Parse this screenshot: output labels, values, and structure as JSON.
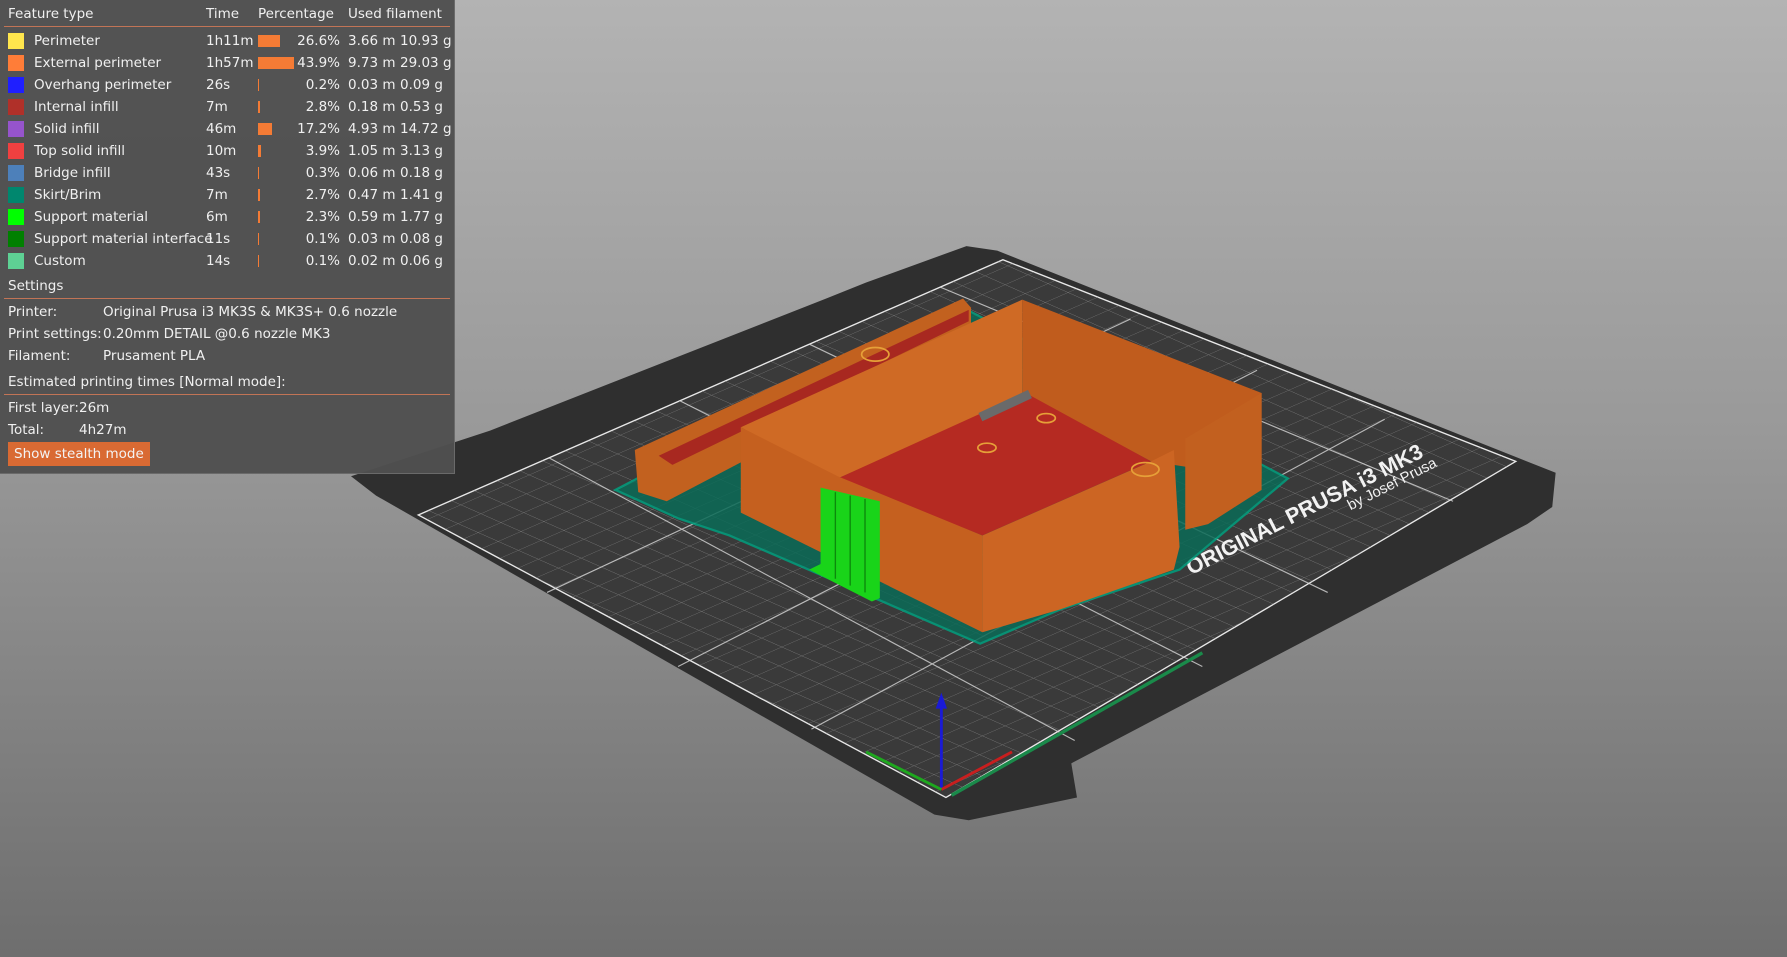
{
  "legend": {
    "headers": {
      "feature": "Feature type",
      "time": "Time",
      "percentage": "Percentage",
      "filament": "Used filament"
    },
    "rows": [
      {
        "name": "Perimeter",
        "color": "#ffe64d",
        "time": "1h11m",
        "percent": 26.6,
        "percent_label": "26.6%",
        "length": "3.66 m",
        "weight": "10.93 g"
      },
      {
        "name": "External perimeter",
        "color": "#ff7d38",
        "time": "1h57m",
        "percent": 43.9,
        "percent_label": "43.9%",
        "length": "9.73 m",
        "weight": "29.03 g"
      },
      {
        "name": "Overhang perimeter",
        "color": "#1f1fff",
        "time": "26s",
        "percent": 0.2,
        "percent_label": "0.2%",
        "length": "0.03 m",
        "weight": "0.09 g"
      },
      {
        "name": "Internal infill",
        "color": "#b03029",
        "time": "7m",
        "percent": 2.8,
        "percent_label": "2.8%",
        "length": "0.18 m",
        "weight": "0.53 g"
      },
      {
        "name": "Solid infill",
        "color": "#9654cc",
        "time": "46m",
        "percent": 17.2,
        "percent_label": "17.2%",
        "length": "4.93 m",
        "weight": "14.72 g"
      },
      {
        "name": "Top solid infill",
        "color": "#f04040",
        "time": "10m",
        "percent": 3.9,
        "percent_label": "3.9%",
        "length": "1.05 m",
        "weight": "3.13 g"
      },
      {
        "name": "Bridge infill",
        "color": "#4d80ba",
        "time": "43s",
        "percent": 0.3,
        "percent_label": "0.3%",
        "length": "0.06 m",
        "weight": "0.18 g"
      },
      {
        "name": "Skirt/Brim",
        "color": "#00876e",
        "time": "7m",
        "percent": 2.7,
        "percent_label": "2.7%",
        "length": "0.47 m",
        "weight": "1.41 g"
      },
      {
        "name": "Support material",
        "color": "#00ff00",
        "time": "6m",
        "percent": 2.3,
        "percent_label": "2.3%",
        "length": "0.59 m",
        "weight": "1.77 g"
      },
      {
        "name": "Support material interface",
        "color": "#008000",
        "time": "11s",
        "percent": 0.1,
        "percent_label": "0.1%",
        "length": "0.03 m",
        "weight": "0.08 g"
      },
      {
        "name": "Custom",
        "color": "#5ed194",
        "time": "14s",
        "percent": 0.1,
        "percent_label": "0.1%",
        "length": "0.02 m",
        "weight": "0.06 g"
      }
    ],
    "bar_color": "#f47b35"
  },
  "settings": {
    "title": "Settings",
    "printer_label": "Printer:",
    "printer": "Original Prusa i3 MK3S & MK3S+ 0.6 nozzle",
    "print_label": "Print settings:",
    "print": "0.20mm DETAIL @0.6 nozzle MK3",
    "filament_label": "Filament:",
    "filament": "Prusament PLA"
  },
  "times": {
    "title": "Estimated printing times [Normal mode]:",
    "first_layer_label": "First layer:",
    "first_layer": "26m",
    "total_label": "Total:",
    "total": "4h27m",
    "stealth_button": "Show stealth mode"
  },
  "bed": {
    "logo_line1": "ORIGINAL PRUSA i3 MK3",
    "logo_line2": "by Josef Prusa"
  },
  "colors": {
    "accent": "#d96a33",
    "model": "#c5601f",
    "top_infill": "#b52a22",
    "skirt": "#00876e",
    "support": "#19d419"
  }
}
